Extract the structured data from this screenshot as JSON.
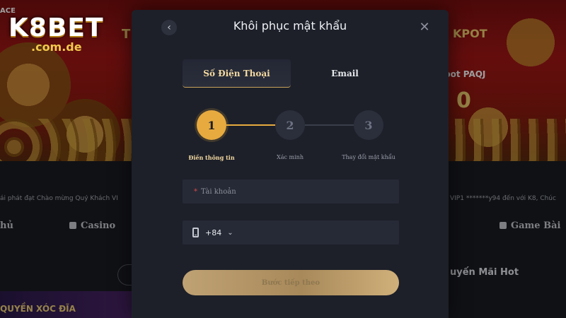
{
  "background": {
    "top_left_text": "ACE",
    "logo_main": "K8BET",
    "logo_domain": ".com.de",
    "jackpot_left": "T",
    "jackpot_right": "KPOT",
    "promo_text": "pot PAQJ",
    "big_number": "0",
    "marquee_left": "ái phát đạt Chào mừng Quý Khách VI",
    "marquee_right": "VIP1 *******y94 đến với K8, Chúc",
    "nav_left": "hủ",
    "nav_casino": "Casino",
    "nav_game": "Game Bài",
    "hot_promo": "uyến Mãi Hot",
    "thumb_text": "QUYỀN XÓC ĐĨA"
  },
  "modal": {
    "back_icon": "chevron-left-icon",
    "title": "Khôi phục mật khẩu",
    "close_icon": "close-icon",
    "tabs": [
      {
        "label": "Số Điện Thoại",
        "active": true
      },
      {
        "label": "Email",
        "active": false
      }
    ],
    "steps": [
      {
        "number": "1",
        "label": "Điền thông tin",
        "active": true
      },
      {
        "number": "2",
        "label": "Xác minh",
        "active": false
      },
      {
        "number": "3",
        "label": "Thay đổi mật khẩu",
        "active": false
      }
    ],
    "account_field": {
      "required_mark": "*",
      "placeholder": "Tài khoản"
    },
    "phone_field": {
      "country_code": "+84",
      "icon": "phone-icon",
      "dropdown_icon": "chevron-down-icon"
    },
    "next_button": "Bước tiếp theo"
  },
  "colors": {
    "accent_gold": "#e7aa3f",
    "modal_bg": "#1d2029",
    "field_bg": "#262a36"
  }
}
